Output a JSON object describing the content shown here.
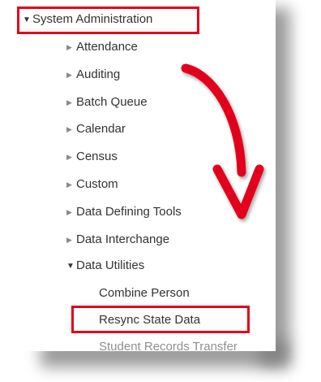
{
  "tree": {
    "root": {
      "label": "System Administration",
      "expanded": true
    },
    "children": [
      {
        "label": "Attendance",
        "expanded": false
      },
      {
        "label": "Auditing",
        "expanded": false
      },
      {
        "label": "Batch Queue",
        "expanded": false
      },
      {
        "label": "Calendar",
        "expanded": false
      },
      {
        "label": "Census",
        "expanded": false
      },
      {
        "label": "Custom",
        "expanded": false
      },
      {
        "label": "Data Defining Tools",
        "expanded": false
      },
      {
        "label": "Data Interchange",
        "expanded": false
      },
      {
        "label": "Data Utilities",
        "expanded": true
      }
    ],
    "data_utilities_children": [
      {
        "label": "Combine Person"
      },
      {
        "label": "Resync State Data"
      },
      {
        "label": "Student Records Transfer"
      }
    ]
  },
  "icons": {
    "expanded": "triangle-down-icon",
    "collapsed": "triangle-right-icon",
    "annotation_arrow": "curved-arrow-icon"
  },
  "colors": {
    "highlight": "#e3001b",
    "text": "#333333"
  }
}
